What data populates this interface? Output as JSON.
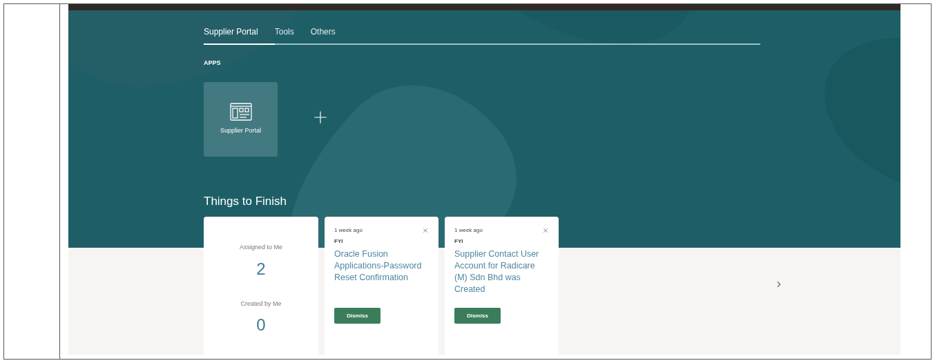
{
  "tabs": [
    {
      "label": "Supplier Portal",
      "selected": true
    },
    {
      "label": "Tools",
      "selected": false
    },
    {
      "label": "Others",
      "selected": false
    }
  ],
  "apps": {
    "heading": "APPS",
    "items": [
      {
        "label": "Supplier Portal"
      }
    ]
  },
  "things_to_finish": {
    "title": "Things to Finish",
    "summary": [
      {
        "label": "Assigned to Me",
        "count": "2"
      },
      {
        "label": "Created by Me",
        "count": "0"
      }
    ],
    "notifications": [
      {
        "time": "1 week ago",
        "category": "FYI",
        "title": "Oracle Fusion Applications-Password Reset Confirmation",
        "action": "Dismiss"
      },
      {
        "time": "1 week ago",
        "category": "FYI",
        "title": "Supplier Contact User Account for Radicare (M) Sdn Bhd was Created",
        "action": "Dismiss"
      }
    ]
  }
}
